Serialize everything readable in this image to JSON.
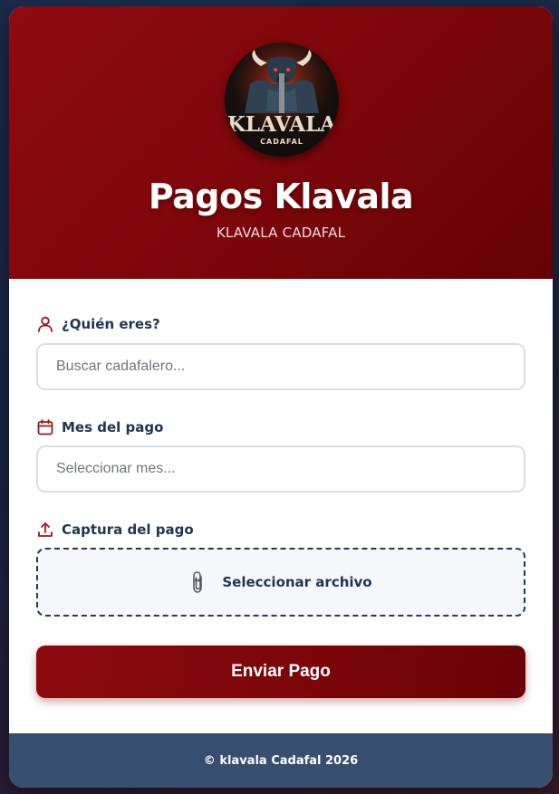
{
  "header": {
    "logo_text": "KLAVALA",
    "logo_subtext": "CADAFAL",
    "title": "Pagos Klavala",
    "subtitle": "KLAVALA CADAFAL"
  },
  "form": {
    "who": {
      "label": "¿Quién eres?",
      "icon": "user-icon",
      "placeholder": "Buscar cadafalero..."
    },
    "month": {
      "label": "Mes del pago",
      "icon": "calendar-icon",
      "placeholder": "Seleccionar mes..."
    },
    "capture": {
      "label": "Captura del pago",
      "icon": "upload-icon",
      "button_label": "Seleccionar archivo",
      "button_icon": "paperclip-icon"
    },
    "submit_label": "Enviar Pago"
  },
  "footer": {
    "text": "© klavala Cadafal 2026"
  },
  "colors": {
    "brand_red": "#7c0609",
    "label_navy": "#1f3550",
    "footer_bg": "#374e6e",
    "icon_red": "#9a1a1d"
  }
}
